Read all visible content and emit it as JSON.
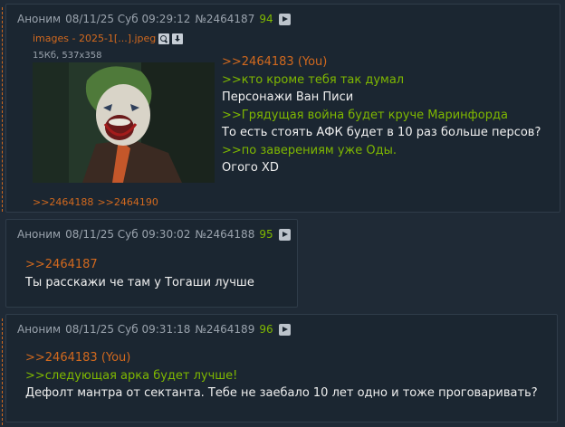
{
  "posts": [
    {
      "author": "Аноним",
      "datetime": "08/11/25 Суб 09:29:12",
      "number": "№2464187",
      "count": "94",
      "file": {
        "name": "images - 2025-1[...].jpeg",
        "meta": "15Кб, 537x358"
      },
      "lines": [
        {
          "kind": "ref",
          "text": ">>2464183 (You)"
        },
        {
          "kind": "quote",
          "text": ">>кто кроме тебя так думал"
        },
        {
          "kind": "txt",
          "text": "Персонажи Ван Писи"
        },
        {
          "kind": "quote",
          "text": ">>Грядущая война будет круче Маринфорда"
        },
        {
          "kind": "txt",
          "text": "То есть стоять АФК будет в 10 раз больше персов?"
        },
        {
          "kind": "quote",
          "text": ">>по заверениям уже Оды."
        },
        {
          "kind": "txt",
          "text": "Огого XD"
        }
      ],
      "backlinks": [
        ">>2464188",
        ">>2464190"
      ]
    },
    {
      "author": "Аноним",
      "datetime": "08/11/25 Суб 09:30:02",
      "number": "№2464188",
      "count": "95",
      "lines": [
        {
          "kind": "ref",
          "text": ">>2464187"
        },
        {
          "kind": "txt",
          "text": "Ты расскажи че там у Тогаши лучше"
        }
      ]
    },
    {
      "author": "Аноним",
      "datetime": "08/11/25 Суб 09:31:18",
      "number": "№2464189",
      "count": "96",
      "lines": [
        {
          "kind": "ref",
          "text": ">>2464183 (You)"
        },
        {
          "kind": "quote",
          "text": ">>следующая арка будет лучше!"
        },
        {
          "kind": "txt",
          "text": "Дефолт мантра от сектанта. Тебе не заебало 10 лет одно и тоже проговаривать?"
        }
      ]
    }
  ],
  "colors": {
    "background": "#1f2a36",
    "post_bg": "#1b2631",
    "reply_link": "#d2691e",
    "greentext": "#7fb800",
    "counter": "#7fb800"
  }
}
